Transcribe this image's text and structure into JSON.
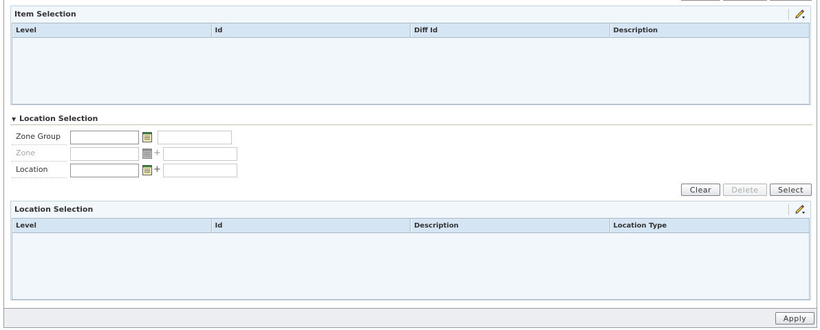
{
  "item_selection": {
    "title": "Item Selection",
    "columns": [
      "Level",
      "Id",
      "Diff Id",
      "Description"
    ],
    "edit_icon": "pencil-edit-icon"
  },
  "location_section": {
    "title": "Location Selection",
    "toggle_icon": "triangle-down-icon",
    "fields": {
      "zone_group": {
        "label": "Zone Group",
        "value": "",
        "description": ""
      },
      "zone": {
        "label": "Zone",
        "value": "",
        "description": "",
        "plus": "+"
      },
      "location": {
        "label": "Location",
        "value": "",
        "description": "",
        "plus": "+"
      }
    },
    "buttons": {
      "clear": "Clear",
      "delete": "Delete",
      "select": "Select"
    }
  },
  "location_selection": {
    "title": "Location Selection",
    "columns": [
      "Level",
      "Id",
      "Description",
      "Location Type"
    ],
    "edit_icon": "pencil-edit-icon"
  },
  "footer": {
    "apply": "Apply"
  },
  "colors": {
    "panel_bg": "#f2f7fc",
    "header_bg": "#d6e5f4",
    "border": "#a9b9c9",
    "section_rule": "#b8c9a8"
  }
}
